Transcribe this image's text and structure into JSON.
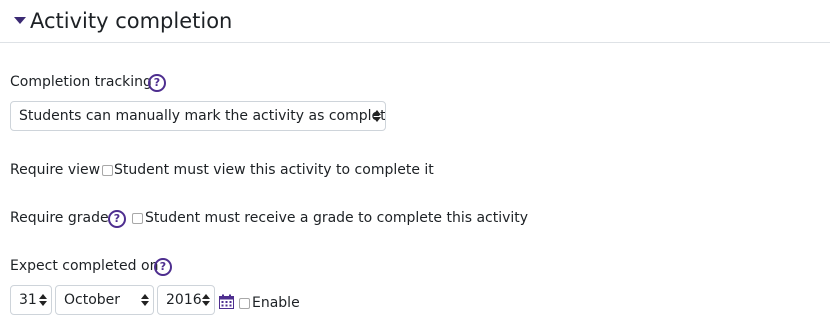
{
  "section": {
    "title": "Activity completion",
    "toggle_icon": "caret-down-icon"
  },
  "completion_tracking": {
    "label": "Completion tracking",
    "help_icon": "question-circle-icon",
    "selected": "Students can manually mark the activity as completed"
  },
  "require_view": {
    "label": "Require view",
    "checkbox_label": "Student must view this activity to complete it",
    "checked": false
  },
  "require_grade": {
    "label": "Require grade",
    "help_icon": "question-circle-icon",
    "checkbox_label": "Student must receive a grade to complete this activity",
    "checked": false
  },
  "expect_completed": {
    "label": "Expect completed on",
    "help_icon": "question-circle-icon",
    "day": "31",
    "month": "October",
    "year": "2016",
    "calendar_icon": "calendar-icon",
    "enable_label": "Enable",
    "enabled": false
  },
  "colors": {
    "accent": "#4e2e8f",
    "text": "#1d2125",
    "border": "#ced4da"
  }
}
